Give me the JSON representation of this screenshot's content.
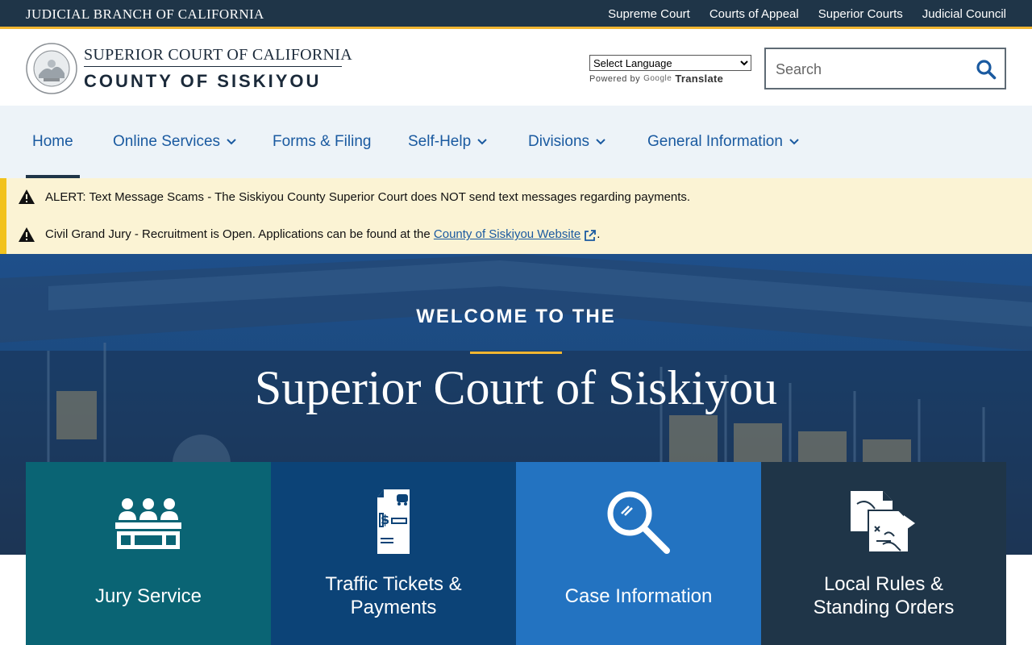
{
  "topbar": {
    "branch": "JUDICIAL BRANCH OF CALIFORNIA",
    "links": [
      "Supreme Court",
      "Courts of Appeal",
      "Superior Courts",
      "Judicial Council"
    ]
  },
  "header": {
    "line1": "SUPERIOR COURT OF CALIFORNIA",
    "line2": "COUNTY OF SISKIYOU",
    "language_select": "Select Language",
    "powered_by": "Powered by",
    "google": "Google",
    "translate": "Translate",
    "search_placeholder": "Search"
  },
  "nav": {
    "items": [
      {
        "label": "Home",
        "active": true
      },
      {
        "label": "Online Services",
        "dropdown": true
      },
      {
        "label": "Forms & Filing"
      },
      {
        "label": "Self-Help",
        "dropdown": true
      },
      {
        "label": "Divisions",
        "dropdown": true
      },
      {
        "label": "General Information",
        "dropdown": true
      }
    ]
  },
  "alerts": [
    {
      "text": "ALERT: Text Message Scams - The Siskiyou County Superior Court does NOT send text messages regarding payments."
    },
    {
      "text": "Civil Grand Jury - Recruitment is Open.  Applications can be found at the ",
      "link": "County of Siskiyou Website",
      "suffix": "."
    }
  ],
  "hero": {
    "welcome": "WELCOME TO THE",
    "title": "Superior Court of Siskiyou"
  },
  "cards": [
    {
      "line1": "Jury Service",
      "line2": "",
      "icon": "jury-icon",
      "color": "#0a6474"
    },
    {
      "line1": "Traffic Tickets &",
      "line2": "Payments",
      "icon": "ticket-icon",
      "color": "#0c4377"
    },
    {
      "line1": "Case Information",
      "line2": "",
      "icon": "magnifier-icon",
      "color": "#2373c1"
    },
    {
      "line1": "Local Rules &",
      "line2": "Standing Orders",
      "icon": "documents-icon",
      "color": "#1f3548"
    }
  ],
  "colors": {
    "navy": "#1f3548",
    "gold": "#f2b631",
    "link_blue": "#1a5aa0",
    "alert_bg": "#fbf3d4"
  }
}
